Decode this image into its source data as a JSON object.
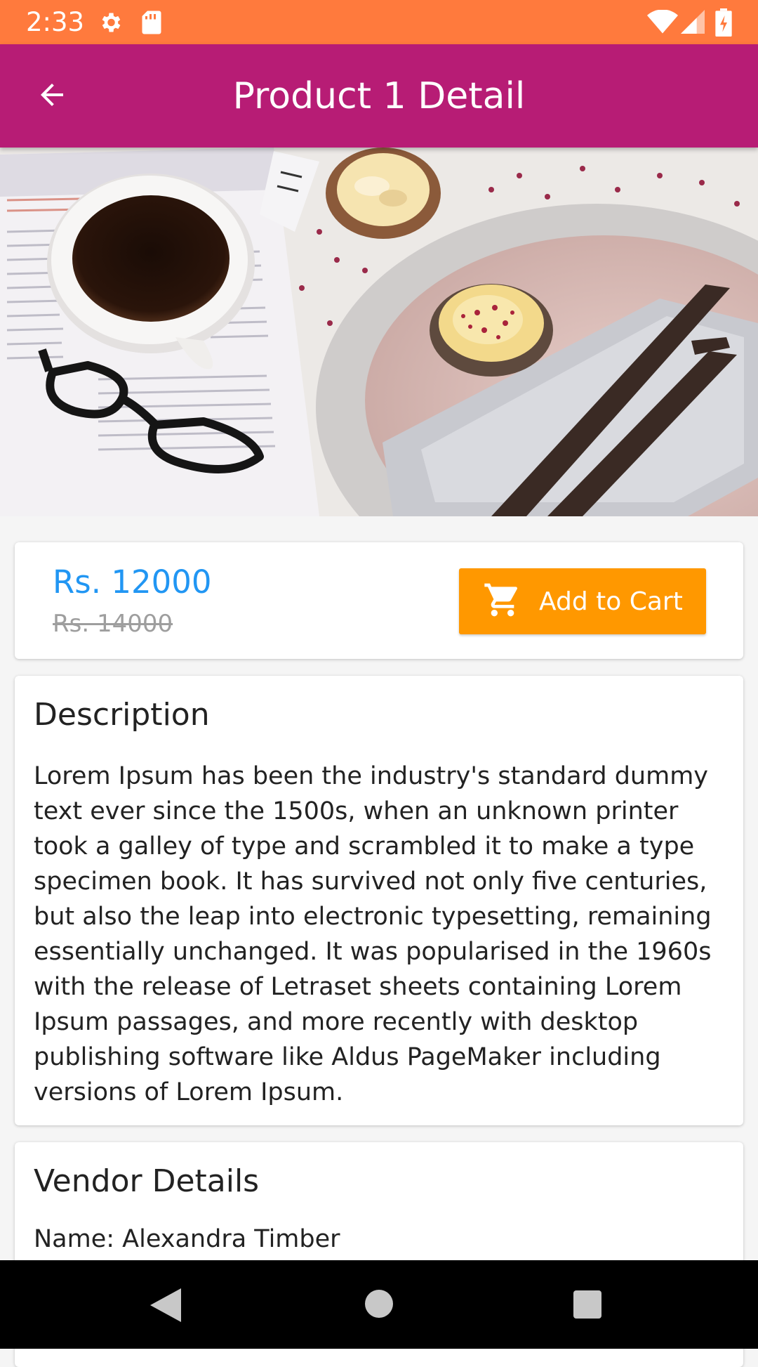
{
  "status_bar": {
    "time": "2:33",
    "icons": [
      "settings-icon",
      "sd-card-icon",
      "wifi-icon",
      "signal-icon",
      "battery-charging-icon"
    ],
    "background": "#ff7a3d"
  },
  "app_bar": {
    "title": "Product 1 Detail",
    "back_icon": "arrow-back-icon",
    "background": "#b71c75"
  },
  "hero": {
    "image": "coffee-cupcakes-photo"
  },
  "price": {
    "current": "Rs. 12000",
    "original": "Rs. 14000",
    "current_color": "#2196f3"
  },
  "cart_button": {
    "label": "Add to Cart",
    "icon": "shopping-cart-icon",
    "color": "#ff9800"
  },
  "description": {
    "heading": "Description",
    "text": "Lorem Ipsum has been the industry's standard dummy text ever since the 1500s, when an unknown printer took a galley of type and scrambled it to make a type specimen book. It has survived not only five centuries, but also the leap into electronic typesetting, remaining essentially unchanged. It was popularised in the 1960s with the release of Letraset sheets containing Lorem Ipsum passages, and more recently with desktop publishing software like Aldus PageMaker including versions of Lorem Ipsum."
  },
  "vendor": {
    "heading": "Vendor Details",
    "name": "Name: Alexandra Timber"
  },
  "nav_bar": {
    "buttons": [
      "back-triangle-icon",
      "home-circle-icon",
      "recents-square-icon"
    ]
  }
}
